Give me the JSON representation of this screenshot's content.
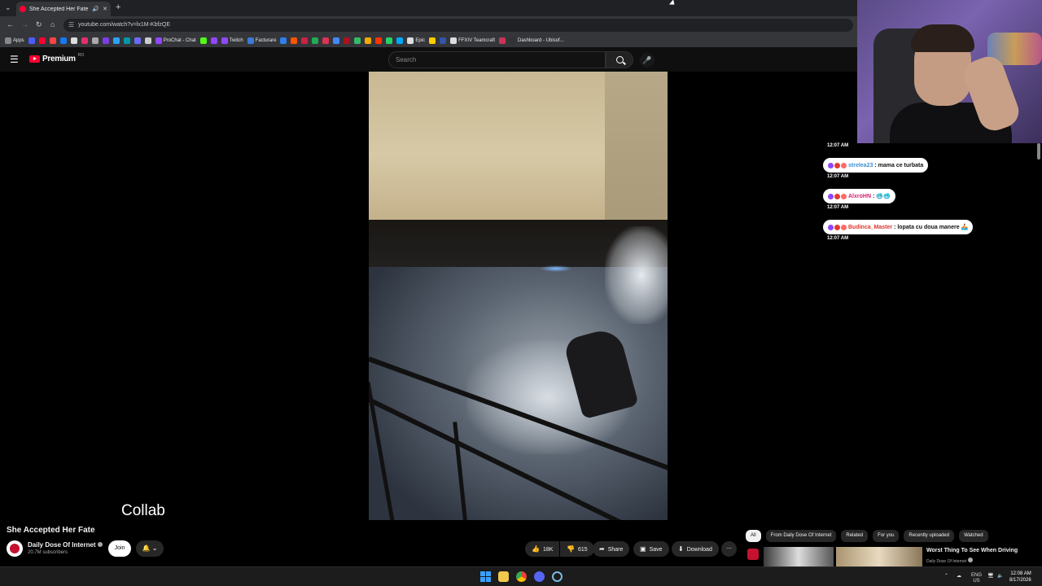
{
  "browser": {
    "tab_title": "She Accepted Her Fate - Yo",
    "new_tab_icon": "plus-icon",
    "url": "youtube.com/watch?v=lx1M-KbfzQE",
    "bookmarks": [
      {
        "label": "Apps",
        "color": "#888888"
      },
      {
        "label": "",
        "color": "#4a5cff"
      },
      {
        "label": "",
        "color": "#ff0033"
      },
      {
        "label": "",
        "color": "#ff4444"
      },
      {
        "label": "",
        "color": "#1877f2"
      },
      {
        "label": "",
        "color": "#dddddd"
      },
      {
        "label": "",
        "color": "#e1306c"
      },
      {
        "label": "",
        "color": "#aaaaaa"
      },
      {
        "label": "",
        "color": "#7b3fe4"
      },
      {
        "label": "",
        "color": "#2ba3f7"
      },
      {
        "label": "",
        "color": "#0099aa"
      },
      {
        "label": "",
        "color": "#6b6bff"
      },
      {
        "label": "",
        "color": "#cccccc"
      },
      {
        "label": "ProChat - Chat",
        "color": "#9147ff"
      },
      {
        "label": "",
        "color": "#53fc18"
      },
      {
        "label": "",
        "color": "#9147ff"
      },
      {
        "label": "Twitch",
        "color": "#9147ff"
      },
      {
        "label": "Facturare",
        "color": "#3a7bd5"
      },
      {
        "label": "",
        "color": "#2f80ed"
      },
      {
        "label": "",
        "color": "#ff5500"
      },
      {
        "label": "",
        "color": "#cc2244"
      },
      {
        "label": "",
        "color": "#22aa55"
      },
      {
        "label": "",
        "color": "#dd3355"
      },
      {
        "label": "",
        "color": "#4488ff"
      },
      {
        "label": "",
        "color": "#aa1122"
      },
      {
        "label": "",
        "color": "#33bb66"
      },
      {
        "label": "",
        "color": "#f2a900"
      },
      {
        "label": "",
        "color": "#ff3300"
      },
      {
        "label": "",
        "color": "#25d366"
      },
      {
        "label": "",
        "color": "#00aaff"
      },
      {
        "label": "Epic",
        "color": "#dddddd"
      },
      {
        "label": "",
        "color": "#ffcc00"
      },
      {
        "label": "",
        "color": "#3355aa"
      },
      {
        "label": "FFXIV Teamcraft",
        "color": "#dddddd"
      },
      {
        "label": "",
        "color": "#cc3355"
      },
      {
        "label": "Dashboard - Ubisof...",
        "color": "#333333"
      }
    ]
  },
  "youtube": {
    "brand": "Premium",
    "region": "RO",
    "search_placeholder": "Search",
    "video": {
      "caption": "Collab",
      "title": "She Accepted Her Fate",
      "channel": "Daily Dose Of Internet",
      "subscribers": "20.7M subscribers",
      "join_label": "Join",
      "likes": "18K",
      "dislikes": "615",
      "share_label": "Share",
      "save_label": "Save",
      "download_label": "Download"
    },
    "chips": [
      "All",
      "From Daily Dose Of Internet",
      "Related",
      "For you",
      "Recently uploaded",
      "Watched"
    ],
    "recommended": {
      "title": "Worst Thing To See When Driving",
      "channel": "Daily Dose Of Internet"
    }
  },
  "stream_chat": [
    {
      "time": "12:07 AM"
    },
    {
      "time": "12:07 AM",
      "user": "strelea23",
      "user_color": "#3a8fd8",
      "text": ": mama ce turbata"
    },
    {
      "time": "12:07 AM",
      "user": "AlxroHN",
      "user_color": "#d4206e",
      "text": ": 🥶🥶"
    },
    {
      "time": "12:07 AM",
      "user": "Budinca_Master",
      "user_color": "#e0342c",
      "text": ": lopata cu doua manere 🚣"
    }
  ],
  "taskbar": {
    "lang": "ENG",
    "region": "US",
    "time": "12:08 AM",
    "date": "8/17/2026"
  }
}
